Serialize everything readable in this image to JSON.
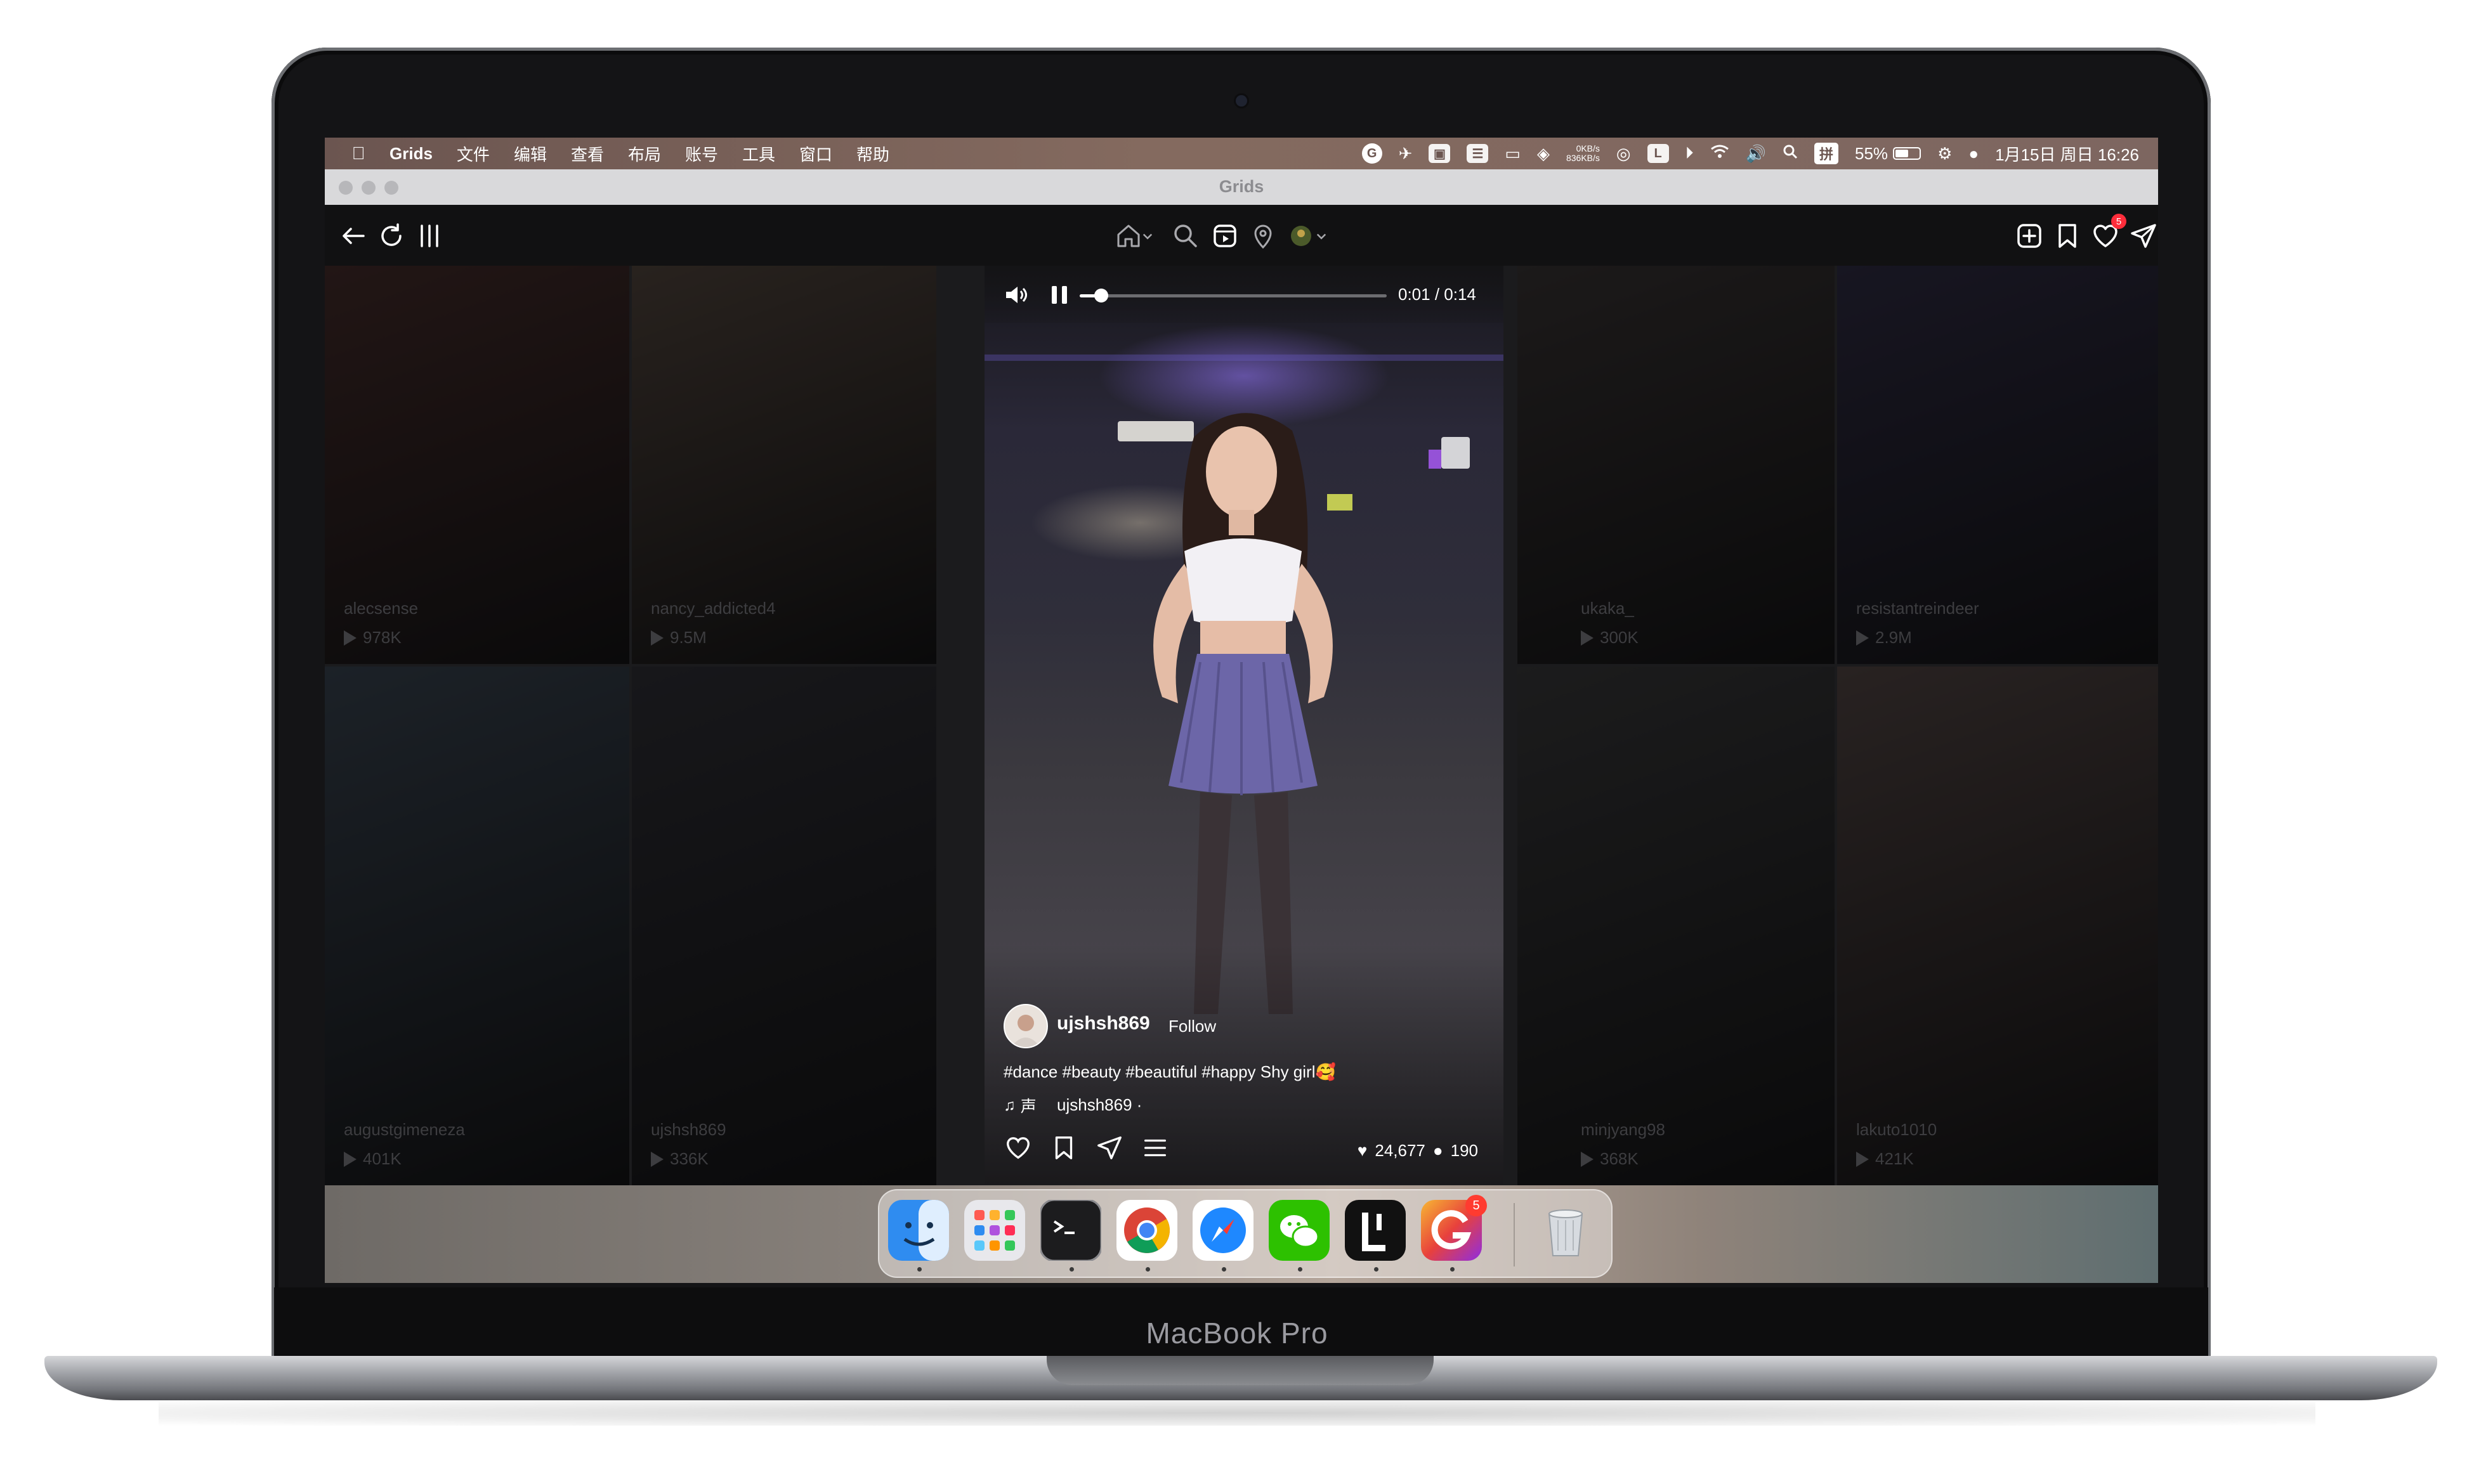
{
  "device": {
    "label": "MacBook Pro"
  },
  "menubar": {
    "app_name": "Grids",
    "menus": [
      "文件",
      "编辑",
      "查看",
      "布局",
      "账号",
      "工具",
      "窗口",
      "帮助"
    ],
    "net_up": "0KB/s",
    "net_down": "836KB/s",
    "input_method": "拼",
    "battery_percent": "55%",
    "battery_level": 0.55,
    "datetime": "1月15日 周日 16:26"
  },
  "window": {
    "title": "Grids"
  },
  "navbar": {
    "activity_badge": "5"
  },
  "feed": {
    "tiles": [
      {
        "user": "alecsense",
        "views": "978K",
        "tint": "#5a3a38"
      },
      {
        "user": "nancy_addicted4",
        "views": "9.5M",
        "tint": "#6a5a50"
      },
      {
        "user": "ukaka_",
        "views": "300K",
        "tint": "#4a4444"
      },
      {
        "user": "resistantreindeer",
        "views": "2.9M",
        "tint": "#3e3a58"
      },
      {
        "user": "augustgimeneza",
        "views": "401K",
        "tint": "#4a5868"
      },
      {
        "user": "ujshsh869",
        "views": "336K",
        "tint": "#3e3e46"
      },
      {
        "user": "minjyang98",
        "views": "368K",
        "tint": "#4a4a4c"
      },
      {
        "user": "lakuto1010",
        "views": "421K",
        "tint": "#6a5a58"
      }
    ]
  },
  "player": {
    "time": "0:01 / 0:14",
    "progress": 0.07,
    "username": "ujshsh869",
    "follow_label": "Follow",
    "caption": "#dance #beauty #beautiful #happy Shy girl🥰",
    "sound_label": "声",
    "sound_user": "ujshsh869 ·",
    "likes": "24,677",
    "comments": "190"
  },
  "dock": {
    "apps": [
      {
        "name": "Finder",
        "color": "#2f8cf0"
      },
      {
        "name": "Launchpad",
        "color": "#e8e8ec"
      },
      {
        "name": "Terminal",
        "color": "#1c1c1e"
      },
      {
        "name": "Chrome",
        "color": "#ffffff"
      },
      {
        "name": "Safari",
        "color": "#1e88ff"
      },
      {
        "name": "WeChat",
        "color": "#2dc100"
      },
      {
        "name": "Lemon",
        "color": "#111111"
      },
      {
        "name": "Grammarly",
        "color": "#e8413c"
      }
    ],
    "grids_badge": "5"
  }
}
